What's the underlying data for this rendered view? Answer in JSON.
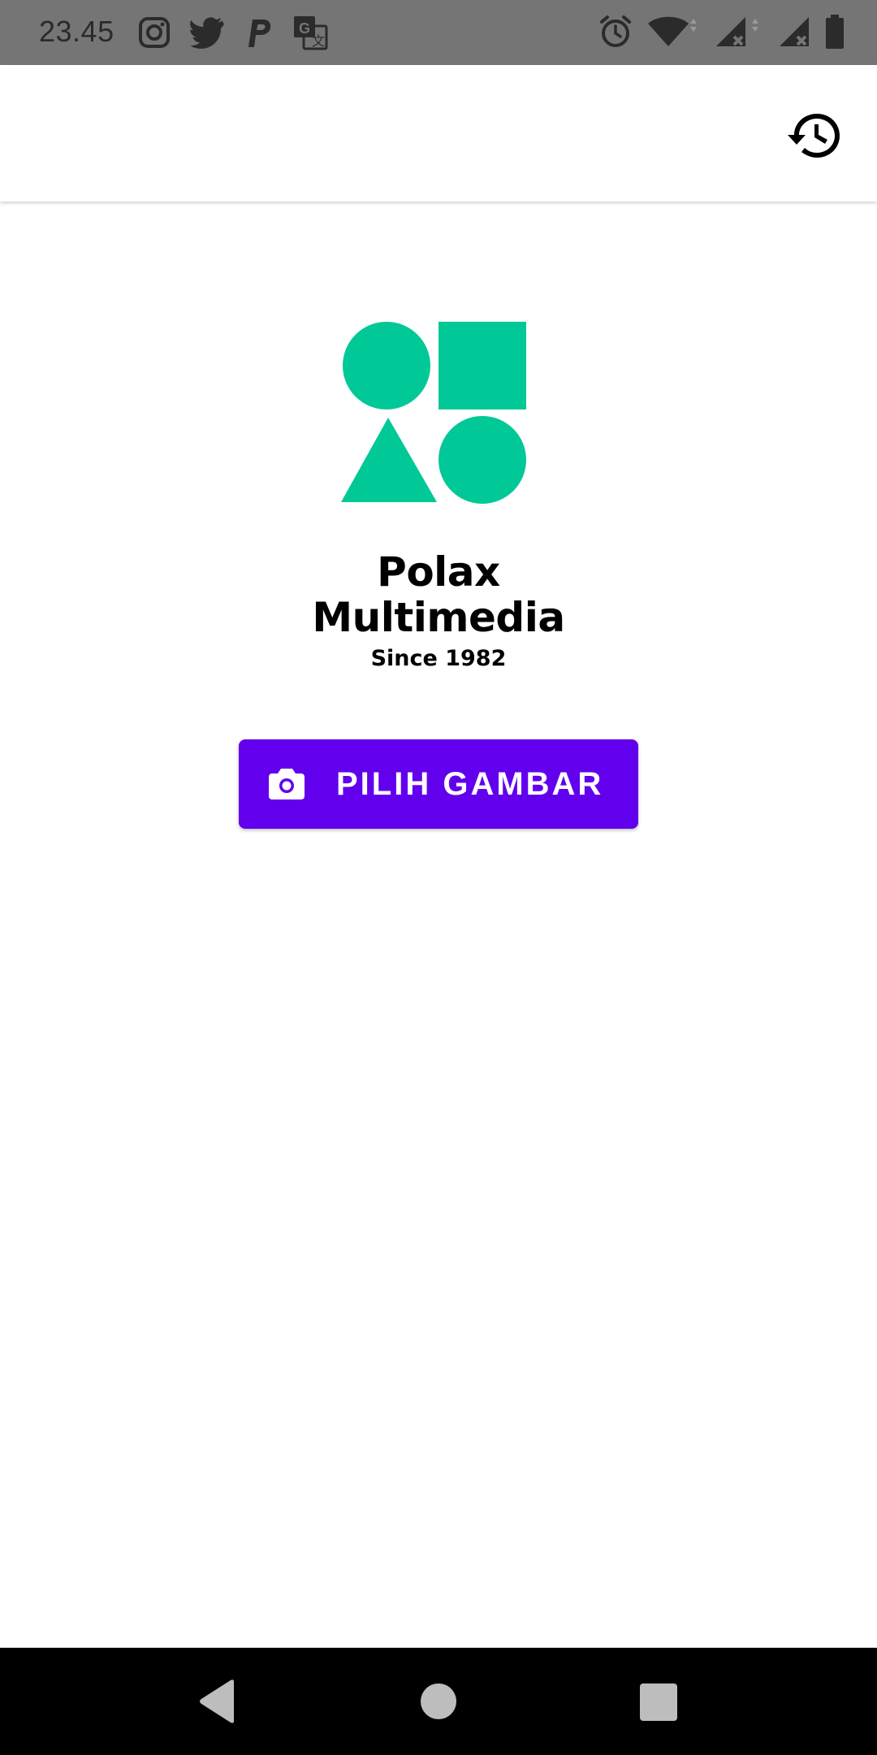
{
  "status_bar": {
    "time": "23.45",
    "notification_icons": [
      "instagram-icon",
      "twitter-icon",
      "p-icon",
      "translate-icon"
    ],
    "system_icons": [
      "alarm-icon",
      "wifi-icon",
      "signal-icon",
      "signal-icon",
      "battery-icon"
    ]
  },
  "app_bar": {
    "history_icon": "history-icon"
  },
  "brand": {
    "line1": "Polax",
    "line2": "Multimedia",
    "since": "Since 1982",
    "logo_color": "#00C896"
  },
  "pick_button": {
    "icon": "camera-icon",
    "label": "PILIH GAMBAR",
    "color": "#6200EE"
  },
  "nav_bar": {
    "buttons": [
      "back-icon",
      "home-icon",
      "recents-icon"
    ]
  }
}
